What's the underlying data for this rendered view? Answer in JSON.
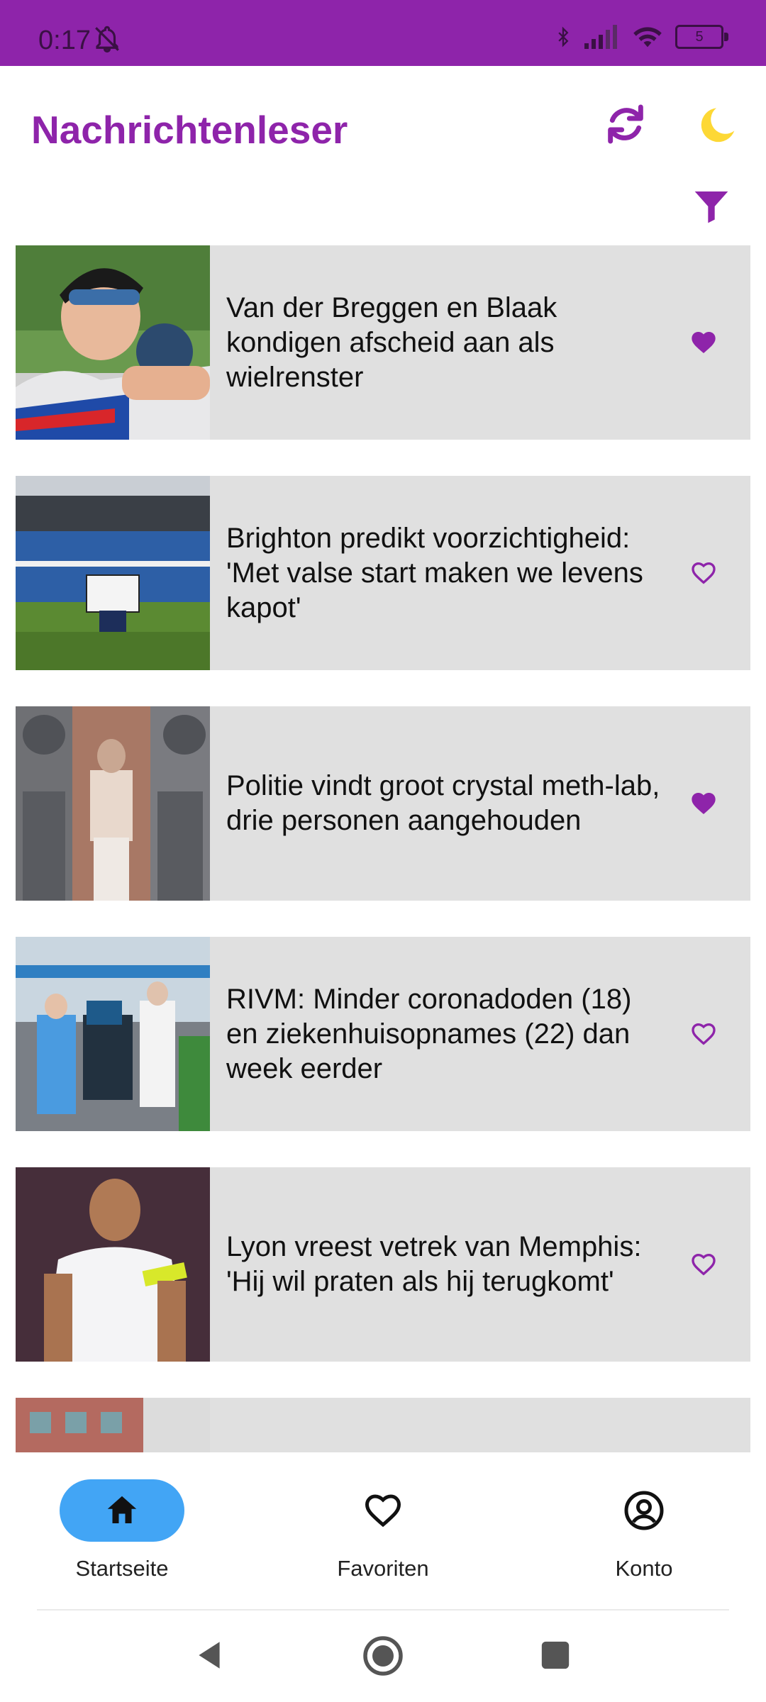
{
  "status": {
    "time": "0:17",
    "battery": "5"
  },
  "app": {
    "title": "Nachrichtenleser",
    "actions": [
      "refresh-icon",
      "moon-icon",
      "filter-icon"
    ],
    "accent": "#8e24aa"
  },
  "articles": [
    {
      "headline": "Van der Breggen en Blaak kondigen afscheid aan als wielrenster",
      "favorite": true
    },
    {
      "headline": "Brighton predikt voorzichtigheid: 'Met valse start maken we levens kapot'",
      "favorite": false
    },
    {
      "headline": "Politie vindt groot crystal meth-lab, drie personen aangehouden",
      "favorite": true
    },
    {
      "headline": "RIVM: Minder coronadoden (18) en ziekenhuisopnames (22) dan week eerder",
      "favorite": false
    },
    {
      "headline": "Lyon vreest vetrek van Memphis: 'Hij wil praten als hij terugkomt'",
      "favorite": false
    },
    {
      "headline": "",
      "favorite": false
    }
  ],
  "bottom_nav": {
    "items": [
      {
        "label": "Startseite",
        "icon": "home-icon",
        "active": true
      },
      {
        "label": "Favoriten",
        "icon": "heart-icon",
        "active": false
      },
      {
        "label": "Konto",
        "icon": "account-icon",
        "active": false
      }
    ],
    "active_color": "#42a5f5"
  }
}
